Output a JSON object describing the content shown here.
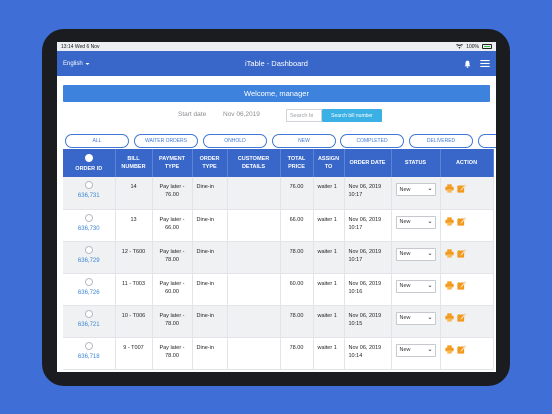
{
  "status_bar": {
    "time_date": "13:14  Wed 6 Nov",
    "battery": "100%"
  },
  "nav": {
    "language": "English",
    "title": "iTable - Dashboard"
  },
  "welcome": "Welcome, manager",
  "filters": {
    "start_date_label": "Start date",
    "start_date_value": "Nov 06,2019",
    "search_placeholder": "Search bi",
    "search_button": "Search bill number"
  },
  "tabs": [
    "ALL",
    "WAITER ORDERS",
    "ONHOLD",
    "NEW",
    "COMPLETED",
    "DELIVERED"
  ],
  "columns": [
    "ORDER ID",
    "BILL NUMBER",
    "PAYMENT TYPE",
    "ORDER TYPE",
    "CUSTOMER DETAILS",
    "TOTAL PRICE",
    "ASSIGN TO",
    "ORDER DATE",
    "STATUS",
    "ACTION"
  ],
  "rows": [
    {
      "order_id": "636,731",
      "bill": "14",
      "payment": "Pay later - 76.00",
      "type": "Dine-in",
      "customer": "",
      "price": "76.00",
      "assign": "waiter 1",
      "date": "Nov 06, 2019 10:17",
      "status": "New"
    },
    {
      "order_id": "636,730",
      "bill": "13",
      "payment": "Pay later - 66.00",
      "type": "Dine-in",
      "customer": "",
      "price": "66.00",
      "assign": "waiter 1",
      "date": "Nov 06, 2019 10:17",
      "status": "New"
    },
    {
      "order_id": "636,729",
      "bill": "12 - T600",
      "payment": "Pay later - 78.00",
      "type": "Dine-in",
      "customer": "",
      "price": "78.00",
      "assign": "waiter 1",
      "date": "Nov 06, 2019 10:17",
      "status": "New"
    },
    {
      "order_id": "636,726",
      "bill": "11 - T003",
      "payment": "Pay later - 60.00",
      "type": "Dine-in",
      "customer": "",
      "price": "60.00",
      "assign": "waiter 1",
      "date": "Nov 06, 2019 10:16",
      "status": "New"
    },
    {
      "order_id": "636,721",
      "bill": "10 - T006",
      "payment": "Pay later - 78.00",
      "type": "Dine-in",
      "customer": "",
      "price": "78.00",
      "assign": "waiter 1",
      "date": "Nov 06, 2019 10:15",
      "status": "New"
    },
    {
      "order_id": "636,718",
      "bill": "9 - T007",
      "payment": "Pay later - 78.00",
      "type": "Dine-in",
      "customer": "",
      "price": "78.00",
      "assign": "waiter 1",
      "date": "Nov 06, 2019 10:14",
      "status": "New"
    }
  ],
  "colors": {
    "background": "#3f6fd6",
    "navbar": "#3867c9",
    "accent": "#3d82dd",
    "link": "#3a86d4",
    "action_icon": "#f29a1f"
  }
}
